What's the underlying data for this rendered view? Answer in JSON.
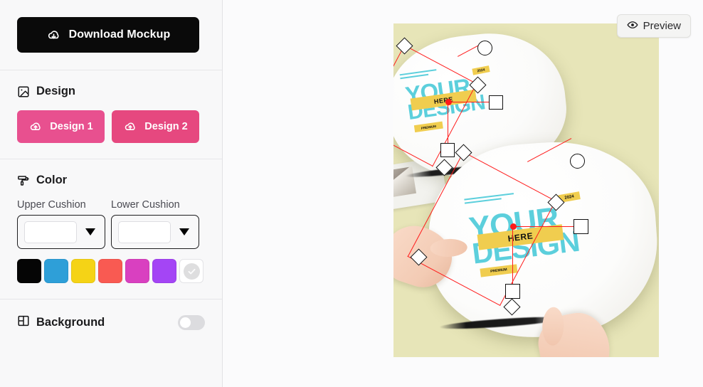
{
  "toolbar": {
    "download_label": "Download Mockup",
    "download_icon": "cloud-download-icon",
    "download_bg": "#0a0a0a"
  },
  "design_section": {
    "title": "Design",
    "icon": "image-icon",
    "buttons": [
      {
        "label": "Design 1",
        "icon": "cloud-upload-icon",
        "color": "#e8508f"
      },
      {
        "label": "Design 2",
        "icon": "cloud-upload-icon",
        "color": "#e6487f"
      }
    ]
  },
  "color_section": {
    "title": "Color",
    "icon": "paint-roller-icon",
    "fields": [
      {
        "label": "Upper Cushion",
        "value": "#ffffff",
        "caret_icon": "caret-down-icon"
      },
      {
        "label": "Lower Cushion",
        "value": "#ffffff",
        "caret_icon": "caret-down-icon"
      }
    ],
    "swatches": [
      {
        "name": "black",
        "hex": "#050505",
        "selected": false
      },
      {
        "name": "blue",
        "hex": "#2e9fd8",
        "selected": false
      },
      {
        "name": "yellow",
        "hex": "#f5d316",
        "selected": false
      },
      {
        "name": "coral",
        "hex": "#f95a52",
        "selected": false
      },
      {
        "name": "magenta",
        "hex": "#d940c0",
        "selected": false
      },
      {
        "name": "purple",
        "hex": "#a445f5",
        "selected": false
      },
      {
        "name": "white",
        "hex": "#ffffff",
        "selected": true,
        "check_icon": "check-icon"
      }
    ]
  },
  "background_section": {
    "title": "Background",
    "icon": "layout-grid-icon",
    "toggle_on": false
  },
  "canvas": {
    "preview_label": "Preview",
    "preview_icon": "eye-icon",
    "stage_bg": "#e7e5b8",
    "selection_color": "#ff1b1b",
    "artworks": [
      {
        "id": "upper",
        "line1": "YOUR",
        "line2": "DESIGN",
        "band_text": "HERE",
        "chip_text": "2024",
        "footer_text": "PREMIUM",
        "text_color": "#5ccfdc",
        "band_color": "#f0cd4f"
      },
      {
        "id": "lower",
        "line1": "YOUR",
        "line2": "DESIGN",
        "band_text": "HERE",
        "chip_text": "2024",
        "footer_text": "PREMIUM",
        "text_color": "#5ccfdc",
        "band_color": "#f0cd4f"
      }
    ]
  }
}
